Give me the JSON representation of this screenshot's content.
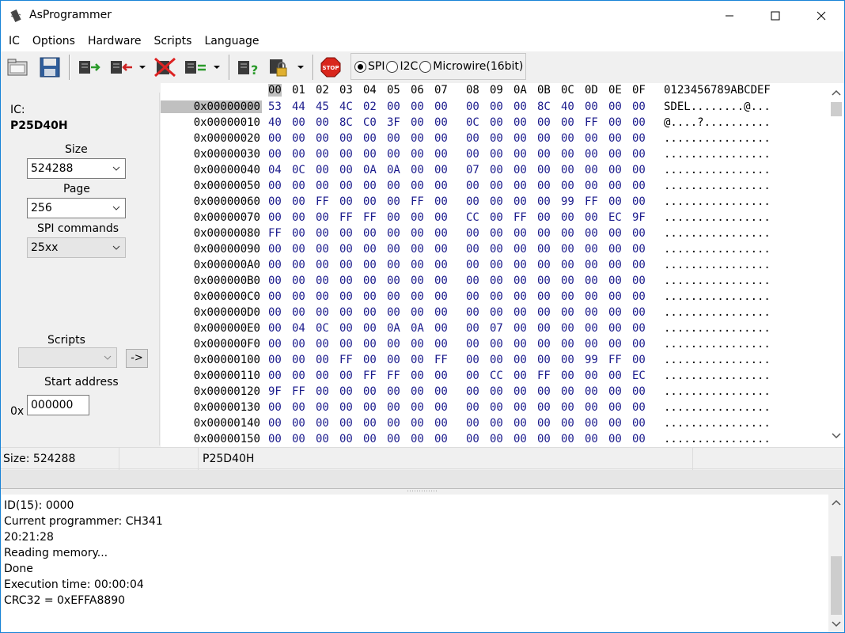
{
  "window": {
    "title": "AsProgrammer"
  },
  "menu": [
    "IC",
    "Options",
    "Hardware",
    "Scripts",
    "Language"
  ],
  "protocol": {
    "options": [
      "SPI",
      "I2C",
      "Microwire(16bit)"
    ],
    "selected": "SPI"
  },
  "ic_panel": {
    "ic_label": "IC:",
    "ic_name": "P25D40H",
    "size_label": "Size",
    "size_value": "524288",
    "page_label": "Page",
    "page_value": "256",
    "spi_label": "SPI commands",
    "spi_value": "25xx",
    "scripts_label": "Scripts",
    "scripts_value": "",
    "run_button": "->",
    "start_label": "Start address",
    "hex_prefix": "0x",
    "start_value": "000000"
  },
  "hex": {
    "columns": [
      "00",
      "01",
      "02",
      "03",
      "04",
      "05",
      "06",
      "07",
      "08",
      "09",
      "0A",
      "0B",
      "0C",
      "0D",
      "0E",
      "0F"
    ],
    "ascii_header": "0123456789ABCDEF",
    "rows": [
      {
        "addr": "0x00000000",
        "bytes": [
          "53",
          "44",
          "45",
          "4C",
          "02",
          "00",
          "00",
          "00",
          "00",
          "00",
          "00",
          "8C",
          "40",
          "00",
          "00",
          "00"
        ],
        "ascii": "SDEL........@..."
      },
      {
        "addr": "0x00000010",
        "bytes": [
          "40",
          "00",
          "00",
          "8C",
          "C0",
          "3F",
          "00",
          "00",
          "0C",
          "00",
          "00",
          "00",
          "00",
          "FF",
          "00",
          "00"
        ],
        "ascii": "@....?.........."
      },
      {
        "addr": "0x00000020",
        "bytes": [
          "00",
          "00",
          "00",
          "00",
          "00",
          "00",
          "00",
          "00",
          "00",
          "00",
          "00",
          "00",
          "00",
          "00",
          "00",
          "00"
        ],
        "ascii": "................"
      },
      {
        "addr": "0x00000030",
        "bytes": [
          "00",
          "00",
          "00",
          "00",
          "00",
          "00",
          "00",
          "00",
          "00",
          "00",
          "00",
          "00",
          "00",
          "00",
          "00",
          "00"
        ],
        "ascii": "................"
      },
      {
        "addr": "0x00000040",
        "bytes": [
          "04",
          "0C",
          "00",
          "00",
          "0A",
          "0A",
          "00",
          "00",
          "07",
          "00",
          "00",
          "00",
          "00",
          "00",
          "00",
          "00"
        ],
        "ascii": "................"
      },
      {
        "addr": "0x00000050",
        "bytes": [
          "00",
          "00",
          "00",
          "00",
          "00",
          "00",
          "00",
          "00",
          "00",
          "00",
          "00",
          "00",
          "00",
          "00",
          "00",
          "00"
        ],
        "ascii": "................"
      },
      {
        "addr": "0x00000060",
        "bytes": [
          "00",
          "00",
          "FF",
          "00",
          "00",
          "00",
          "FF",
          "00",
          "00",
          "00",
          "00",
          "00",
          "99",
          "FF",
          "00",
          "00"
        ],
        "ascii": "................"
      },
      {
        "addr": "0x00000070",
        "bytes": [
          "00",
          "00",
          "00",
          "FF",
          "FF",
          "00",
          "00",
          "00",
          "CC",
          "00",
          "FF",
          "00",
          "00",
          "00",
          "EC",
          "9F"
        ],
        "ascii": "................"
      },
      {
        "addr": "0x00000080",
        "bytes": [
          "FF",
          "00",
          "00",
          "00",
          "00",
          "00",
          "00",
          "00",
          "00",
          "00",
          "00",
          "00",
          "00",
          "00",
          "00",
          "00"
        ],
        "ascii": "................"
      },
      {
        "addr": "0x00000090",
        "bytes": [
          "00",
          "00",
          "00",
          "00",
          "00",
          "00",
          "00",
          "00",
          "00",
          "00",
          "00",
          "00",
          "00",
          "00",
          "00",
          "00"
        ],
        "ascii": "................"
      },
      {
        "addr": "0x000000A0",
        "bytes": [
          "00",
          "00",
          "00",
          "00",
          "00",
          "00",
          "00",
          "00",
          "00",
          "00",
          "00",
          "00",
          "00",
          "00",
          "00",
          "00"
        ],
        "ascii": "................"
      },
      {
        "addr": "0x000000B0",
        "bytes": [
          "00",
          "00",
          "00",
          "00",
          "00",
          "00",
          "00",
          "00",
          "00",
          "00",
          "00",
          "00",
          "00",
          "00",
          "00",
          "00"
        ],
        "ascii": "................"
      },
      {
        "addr": "0x000000C0",
        "bytes": [
          "00",
          "00",
          "00",
          "00",
          "00",
          "00",
          "00",
          "00",
          "00",
          "00",
          "00",
          "00",
          "00",
          "00",
          "00",
          "00"
        ],
        "ascii": "................"
      },
      {
        "addr": "0x000000D0",
        "bytes": [
          "00",
          "00",
          "00",
          "00",
          "00",
          "00",
          "00",
          "00",
          "00",
          "00",
          "00",
          "00",
          "00",
          "00",
          "00",
          "00"
        ],
        "ascii": "................"
      },
      {
        "addr": "0x000000E0",
        "bytes": [
          "00",
          "04",
          "0C",
          "00",
          "00",
          "0A",
          "0A",
          "00",
          "00",
          "07",
          "00",
          "00",
          "00",
          "00",
          "00",
          "00"
        ],
        "ascii": "................"
      },
      {
        "addr": "0x000000F0",
        "bytes": [
          "00",
          "00",
          "00",
          "00",
          "00",
          "00",
          "00",
          "00",
          "00",
          "00",
          "00",
          "00",
          "00",
          "00",
          "00",
          "00"
        ],
        "ascii": "................"
      },
      {
        "addr": "0x00000100",
        "bytes": [
          "00",
          "00",
          "00",
          "FF",
          "00",
          "00",
          "00",
          "FF",
          "00",
          "00",
          "00",
          "00",
          "00",
          "99",
          "FF",
          "00"
        ],
        "ascii": "................"
      },
      {
        "addr": "0x00000110",
        "bytes": [
          "00",
          "00",
          "00",
          "00",
          "FF",
          "FF",
          "00",
          "00",
          "00",
          "CC",
          "00",
          "FF",
          "00",
          "00",
          "00",
          "EC"
        ],
        "ascii": "................"
      },
      {
        "addr": "0x00000120",
        "bytes": [
          "9F",
          "FF",
          "00",
          "00",
          "00",
          "00",
          "00",
          "00",
          "00",
          "00",
          "00",
          "00",
          "00",
          "00",
          "00",
          "00"
        ],
        "ascii": "................"
      },
      {
        "addr": "0x00000130",
        "bytes": [
          "00",
          "00",
          "00",
          "00",
          "00",
          "00",
          "00",
          "00",
          "00",
          "00",
          "00",
          "00",
          "00",
          "00",
          "00",
          "00"
        ],
        "ascii": "................"
      },
      {
        "addr": "0x00000140",
        "bytes": [
          "00",
          "00",
          "00",
          "00",
          "00",
          "00",
          "00",
          "00",
          "00",
          "00",
          "00",
          "00",
          "00",
          "00",
          "00",
          "00"
        ],
        "ascii": "................"
      },
      {
        "addr": "0x00000150",
        "bytes": [
          "00",
          "00",
          "00",
          "00",
          "00",
          "00",
          "00",
          "00",
          "00",
          "00",
          "00",
          "00",
          "00",
          "00",
          "00",
          "00"
        ],
        "ascii": "................"
      }
    ]
  },
  "status": {
    "size": "Size: 524288",
    "middle": "",
    "chip": "P25D40H"
  },
  "log": [
    "ID(15): 0000",
    "Current programmer: CH341",
    "20:21:28",
    "Reading memory...",
    "Done",
    "Execution time: 00:00:04",
    "CRC32 = 0xEFFA8890"
  ],
  "colors": {
    "hex_value": "#1a1a8c",
    "selection": "#c0c0c0",
    "window_border": "#1883d7"
  },
  "icons": [
    "chip-app-icon",
    "open-folder-icon",
    "save-icon",
    "read-icon",
    "write-icon",
    "erase-icon",
    "verify-icon",
    "blank-check-icon",
    "lock-icon",
    "stop-icon"
  ]
}
